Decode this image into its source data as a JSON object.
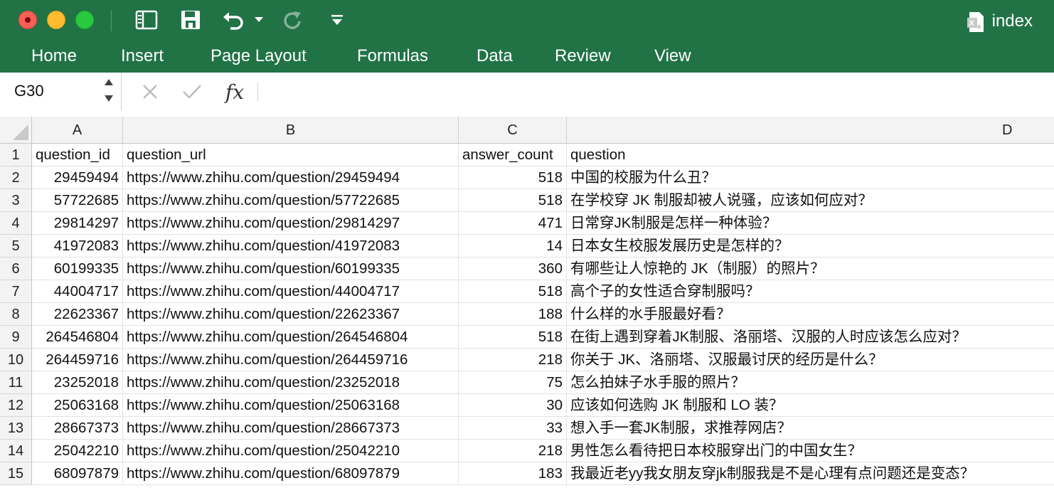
{
  "window": {
    "title": "index",
    "title_icon": "excel-doc-icon",
    "accent_color": "#217346"
  },
  "quick_access": {
    "items": [
      "sidebar-toggle-icon",
      "save-icon",
      "undo-icon",
      "undo-dropdown-icon",
      "redo-icon",
      "customize-toolbar-icon"
    ]
  },
  "ribbon": {
    "tabs": [
      "Home",
      "Insert",
      "Page Layout",
      "Formulas",
      "Data",
      "Review",
      "View"
    ]
  },
  "formula_bar": {
    "name_box": "G30",
    "cancel_icon": "x-icon",
    "confirm_icon": "check-icon",
    "fx_label": "fx",
    "formula_value": ""
  },
  "sheet": {
    "column_headers": [
      "A",
      "B",
      "C",
      "D"
    ],
    "rows": [
      {
        "row": "1",
        "a": "question_id",
        "b": "question_url",
        "c": "answer_count",
        "d": "question"
      },
      {
        "row": "2",
        "a": "29459494",
        "b": "https://www.zhihu.com/question/29459494",
        "c": "518",
        "d": "中国的校服为什么丑？"
      },
      {
        "row": "3",
        "a": "57722685",
        "b": "https://www.zhihu.com/question/57722685",
        "c": "518",
        "d": "在学校穿 JK 制服却被人说骚，应该如何应对？"
      },
      {
        "row": "4",
        "a": "29814297",
        "b": "https://www.zhihu.com/question/29814297",
        "c": "471",
        "d": "日常穿JK制服是怎样一种体验？"
      },
      {
        "row": "5",
        "a": "41972083",
        "b": "https://www.zhihu.com/question/41972083",
        "c": "14",
        "d": "日本女生校服发展历史是怎样的？"
      },
      {
        "row": "6",
        "a": "60199335",
        "b": "https://www.zhihu.com/question/60199335",
        "c": "360",
        "d": "有哪些让人惊艳的 JK（制服）的照片？"
      },
      {
        "row": "7",
        "a": "44004717",
        "b": "https://www.zhihu.com/question/44004717",
        "c": "518",
        "d": "高个子的女性适合穿制服吗？"
      },
      {
        "row": "8",
        "a": "22623367",
        "b": "https://www.zhihu.com/question/22623367",
        "c": "188",
        "d": "什么样的水手服最好看？"
      },
      {
        "row": "9",
        "a": "264546804",
        "b": "https://www.zhihu.com/question/264546804",
        "c": "518",
        "d": "在街上遇到穿着JK制服、洛丽塔、汉服的人时应该怎么应对？"
      },
      {
        "row": "10",
        "a": "264459716",
        "b": "https://www.zhihu.com/question/264459716",
        "c": "218",
        "d": "你关于 JK、洛丽塔、汉服最讨厌的经历是什么？"
      },
      {
        "row": "11",
        "a": "23252018",
        "b": "https://www.zhihu.com/question/23252018",
        "c": "75",
        "d": "怎么拍妹子水手服的照片？"
      },
      {
        "row": "12",
        "a": "25063168",
        "b": "https://www.zhihu.com/question/25063168",
        "c": "30",
        "d": "应该如何选购 JK 制服和 LO 装？"
      },
      {
        "row": "13",
        "a": "28667373",
        "b": "https://www.zhihu.com/question/28667373",
        "c": "33",
        "d": "想入手一套JK制服，求推荐网店？"
      },
      {
        "row": "14",
        "a": "25042210",
        "b": "https://www.zhihu.com/question/25042210",
        "c": "218",
        "d": "男性怎么看待把日本校服穿出门的中国女生？"
      },
      {
        "row": "15",
        "a": "68097879",
        "b": "https://www.zhihu.com/question/68097879",
        "c": "183",
        "d": "我最近老yy我女朋友穿jk制服我是不是心理有点问题还是变态？"
      }
    ]
  }
}
